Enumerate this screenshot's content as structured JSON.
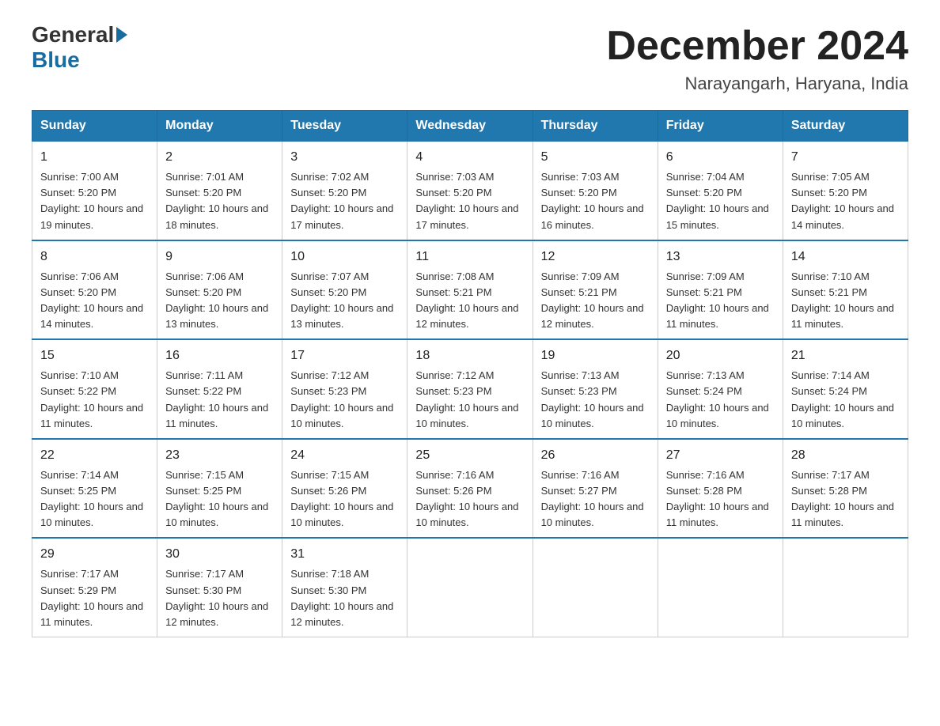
{
  "logo": {
    "general": "General",
    "blue": "Blue"
  },
  "header": {
    "month_year": "December 2024",
    "location": "Narayangarh, Haryana, India"
  },
  "weekdays": [
    "Sunday",
    "Monday",
    "Tuesday",
    "Wednesday",
    "Thursday",
    "Friday",
    "Saturday"
  ],
  "weeks": [
    [
      {
        "day": "1",
        "sunrise": "7:00 AM",
        "sunset": "5:20 PM",
        "daylight": "10 hours and 19 minutes."
      },
      {
        "day": "2",
        "sunrise": "7:01 AM",
        "sunset": "5:20 PM",
        "daylight": "10 hours and 18 minutes."
      },
      {
        "day": "3",
        "sunrise": "7:02 AM",
        "sunset": "5:20 PM",
        "daylight": "10 hours and 17 minutes."
      },
      {
        "day": "4",
        "sunrise": "7:03 AM",
        "sunset": "5:20 PM",
        "daylight": "10 hours and 17 minutes."
      },
      {
        "day": "5",
        "sunrise": "7:03 AM",
        "sunset": "5:20 PM",
        "daylight": "10 hours and 16 minutes."
      },
      {
        "day": "6",
        "sunrise": "7:04 AM",
        "sunset": "5:20 PM",
        "daylight": "10 hours and 15 minutes."
      },
      {
        "day": "7",
        "sunrise": "7:05 AM",
        "sunset": "5:20 PM",
        "daylight": "10 hours and 14 minutes."
      }
    ],
    [
      {
        "day": "8",
        "sunrise": "7:06 AM",
        "sunset": "5:20 PM",
        "daylight": "10 hours and 14 minutes."
      },
      {
        "day": "9",
        "sunrise": "7:06 AM",
        "sunset": "5:20 PM",
        "daylight": "10 hours and 13 minutes."
      },
      {
        "day": "10",
        "sunrise": "7:07 AM",
        "sunset": "5:20 PM",
        "daylight": "10 hours and 13 minutes."
      },
      {
        "day": "11",
        "sunrise": "7:08 AM",
        "sunset": "5:21 PM",
        "daylight": "10 hours and 12 minutes."
      },
      {
        "day": "12",
        "sunrise": "7:09 AM",
        "sunset": "5:21 PM",
        "daylight": "10 hours and 12 minutes."
      },
      {
        "day": "13",
        "sunrise": "7:09 AM",
        "sunset": "5:21 PM",
        "daylight": "10 hours and 11 minutes."
      },
      {
        "day": "14",
        "sunrise": "7:10 AM",
        "sunset": "5:21 PM",
        "daylight": "10 hours and 11 minutes."
      }
    ],
    [
      {
        "day": "15",
        "sunrise": "7:10 AM",
        "sunset": "5:22 PM",
        "daylight": "10 hours and 11 minutes."
      },
      {
        "day": "16",
        "sunrise": "7:11 AM",
        "sunset": "5:22 PM",
        "daylight": "10 hours and 11 minutes."
      },
      {
        "day": "17",
        "sunrise": "7:12 AM",
        "sunset": "5:23 PM",
        "daylight": "10 hours and 10 minutes."
      },
      {
        "day": "18",
        "sunrise": "7:12 AM",
        "sunset": "5:23 PM",
        "daylight": "10 hours and 10 minutes."
      },
      {
        "day": "19",
        "sunrise": "7:13 AM",
        "sunset": "5:23 PM",
        "daylight": "10 hours and 10 minutes."
      },
      {
        "day": "20",
        "sunrise": "7:13 AM",
        "sunset": "5:24 PM",
        "daylight": "10 hours and 10 minutes."
      },
      {
        "day": "21",
        "sunrise": "7:14 AM",
        "sunset": "5:24 PM",
        "daylight": "10 hours and 10 minutes."
      }
    ],
    [
      {
        "day": "22",
        "sunrise": "7:14 AM",
        "sunset": "5:25 PM",
        "daylight": "10 hours and 10 minutes."
      },
      {
        "day": "23",
        "sunrise": "7:15 AM",
        "sunset": "5:25 PM",
        "daylight": "10 hours and 10 minutes."
      },
      {
        "day": "24",
        "sunrise": "7:15 AM",
        "sunset": "5:26 PM",
        "daylight": "10 hours and 10 minutes."
      },
      {
        "day": "25",
        "sunrise": "7:16 AM",
        "sunset": "5:26 PM",
        "daylight": "10 hours and 10 minutes."
      },
      {
        "day": "26",
        "sunrise": "7:16 AM",
        "sunset": "5:27 PM",
        "daylight": "10 hours and 10 minutes."
      },
      {
        "day": "27",
        "sunrise": "7:16 AM",
        "sunset": "5:28 PM",
        "daylight": "10 hours and 11 minutes."
      },
      {
        "day": "28",
        "sunrise": "7:17 AM",
        "sunset": "5:28 PM",
        "daylight": "10 hours and 11 minutes."
      }
    ],
    [
      {
        "day": "29",
        "sunrise": "7:17 AM",
        "sunset": "5:29 PM",
        "daylight": "10 hours and 11 minutes."
      },
      {
        "day": "30",
        "sunrise": "7:17 AM",
        "sunset": "5:30 PM",
        "daylight": "10 hours and 12 minutes."
      },
      {
        "day": "31",
        "sunrise": "7:18 AM",
        "sunset": "5:30 PM",
        "daylight": "10 hours and 12 minutes."
      },
      null,
      null,
      null,
      null
    ]
  ]
}
